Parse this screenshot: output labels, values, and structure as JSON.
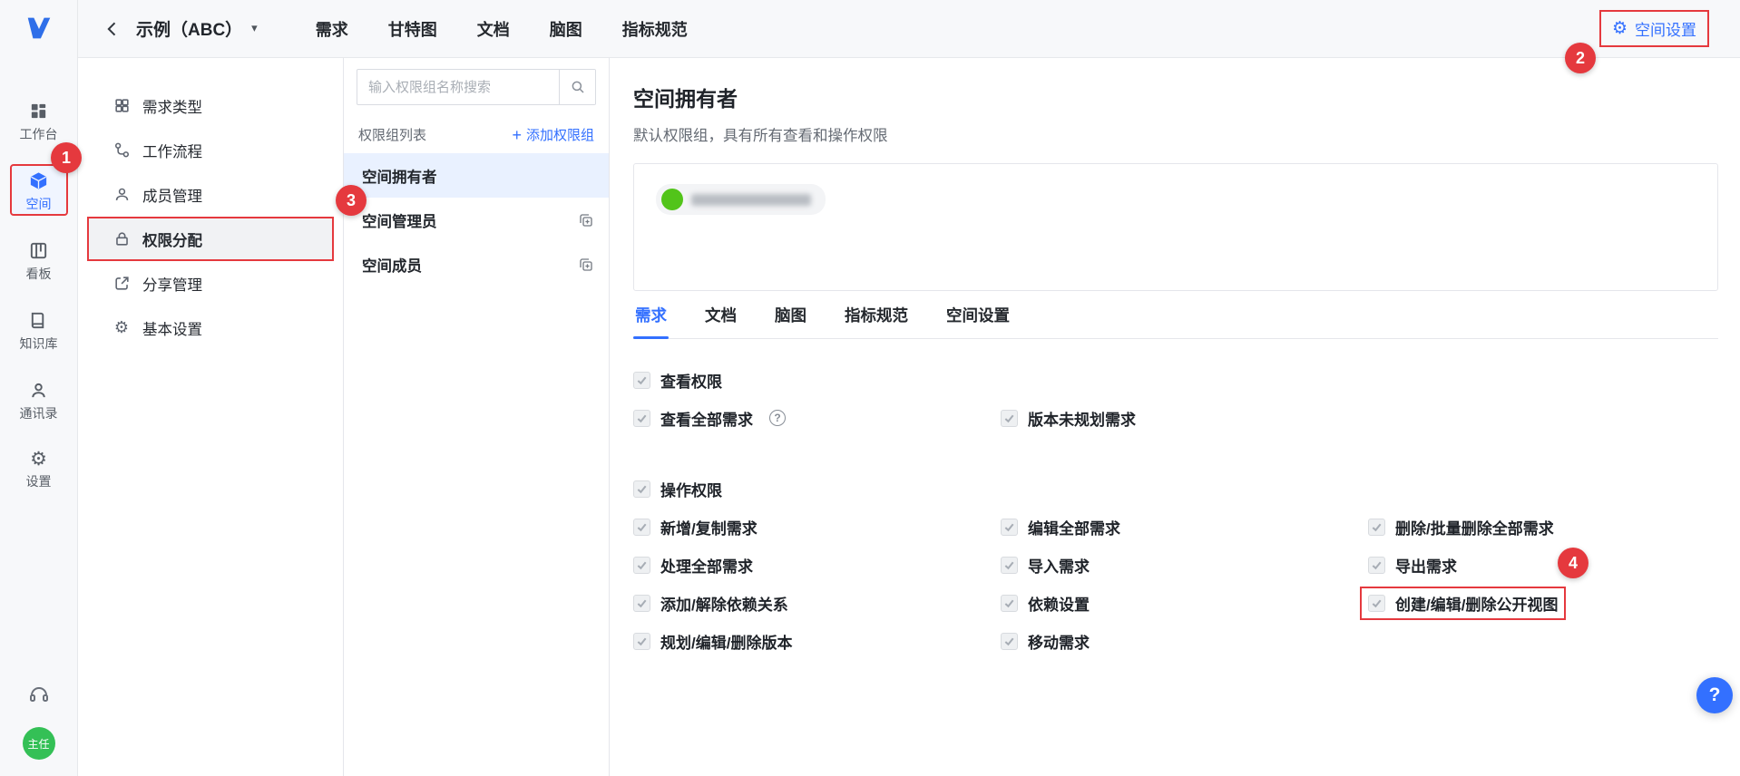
{
  "app": {
    "accent": "#3370ff",
    "annotation_color": "#e5393e",
    "help_glyph": "?",
    "gear_glyph": "⚙",
    "caret_glyph": "▾",
    "plus_glyph": "+"
  },
  "left_rail": {
    "items": [
      {
        "label": "工作台"
      },
      {
        "label": "空间",
        "active": true
      },
      {
        "label": "看板"
      },
      {
        "label": "知识库"
      },
      {
        "label": "通讯录"
      },
      {
        "label": "设置"
      }
    ],
    "avatar_label": "主任"
  },
  "header": {
    "space_name": "示例（ABC）",
    "tabs": [
      {
        "label": "需求"
      },
      {
        "label": "甘特图"
      },
      {
        "label": "文档"
      },
      {
        "label": "脑图"
      },
      {
        "label": "指标规范"
      }
    ],
    "settings_button": "空间设置"
  },
  "settings_nav": {
    "items": [
      {
        "label": "需求类型"
      },
      {
        "label": "工作流程"
      },
      {
        "label": "成员管理"
      },
      {
        "label": "权限分配",
        "active": true
      },
      {
        "label": "分享管理"
      },
      {
        "label": "基本设置"
      }
    ]
  },
  "groups_panel": {
    "search_placeholder": "输入权限组名称搜索",
    "list_title": "权限组列表",
    "add_group_label": "添加权限组",
    "groups": [
      {
        "name": "空间拥有者",
        "active": true
      },
      {
        "name": "空间管理员",
        "copyable": true
      },
      {
        "name": "空间成员",
        "copyable": true
      }
    ]
  },
  "main": {
    "title": "空间拥有者",
    "subtitle": "默认权限组，具有所有查看和操作权限",
    "tabs": [
      {
        "label": "需求",
        "active": true
      },
      {
        "label": "文档"
      },
      {
        "label": "脑图"
      },
      {
        "label": "指标规范"
      },
      {
        "label": "空间设置"
      }
    ],
    "view_section": {
      "header": "查看权限",
      "row": [
        "查看全部需求",
        "版本未规划需求"
      ]
    },
    "op_section": {
      "header": "操作权限",
      "rows": [
        [
          "新增/复制需求",
          "编辑全部需求",
          "删除/批量删除全部需求"
        ],
        [
          "处理全部需求",
          "导入需求",
          "导出需求"
        ],
        [
          "添加/解除依赖关系",
          "依赖设置",
          "创建/编辑/删除公开视图"
        ],
        [
          "规划/编辑/删除版本",
          "移动需求"
        ]
      ],
      "highlighted": "创建/编辑/删除公开视图"
    }
  },
  "annotations": {
    "steps": [
      "1",
      "2",
      "3",
      "4"
    ]
  }
}
